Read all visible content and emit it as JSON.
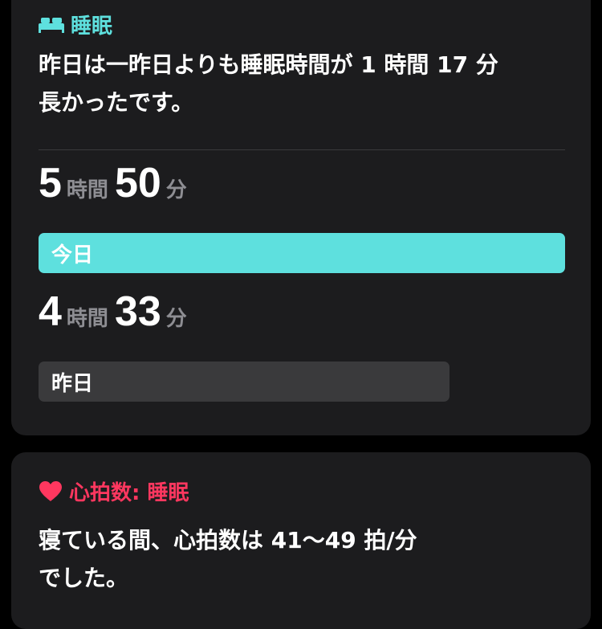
{
  "sleep_card": {
    "header": {
      "icon": "bed-icon",
      "title": "睡眠",
      "accent_color": "#5ee0de"
    },
    "summary_line1": "昨日は一昨日よりも睡眠時間が 1 時間 17 分",
    "summary_line2": "長かったです。",
    "today": {
      "hours": "5",
      "hours_unit": "時間",
      "minutes": "50",
      "minutes_unit": "分",
      "label": "今日",
      "bar_fraction": 1.0,
      "bar_color": "#5ee0de"
    },
    "yesterday": {
      "hours": "4",
      "hours_unit": "時間",
      "minutes": "33",
      "minutes_unit": "分",
      "label": "昨日",
      "bar_fraction": 0.78,
      "bar_color": "#3a3a3c"
    }
  },
  "heart_rate_card": {
    "header": {
      "icon": "heart-icon",
      "title": "心拍数: 睡眠",
      "accent_color": "#ff375f"
    },
    "summary_line1": "寝ている間、心拍数は 41〜49 拍/分",
    "summary_line2": "でした。"
  }
}
